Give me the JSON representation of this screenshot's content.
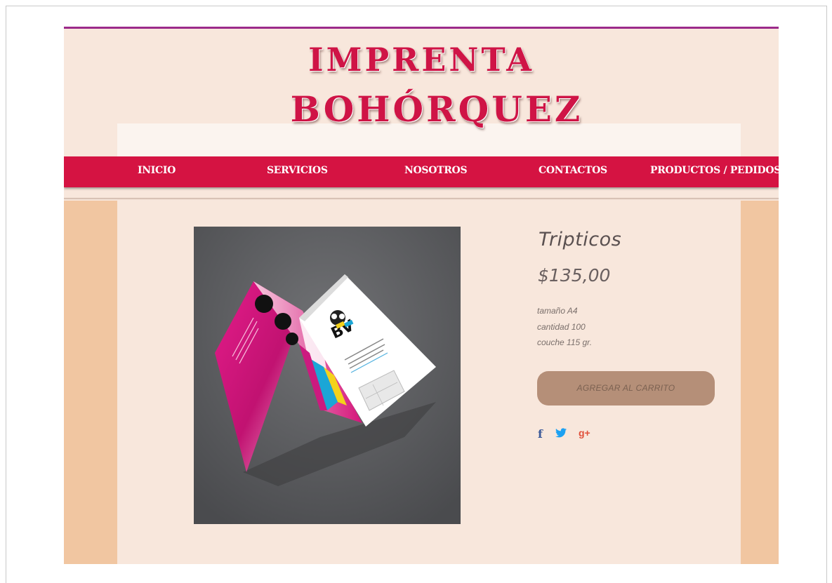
{
  "header": {
    "title_line1": "IMPRENTA",
    "title_line2": "BOHÓRQUEZ"
  },
  "nav": {
    "items": [
      "INICIO",
      "SERVICIOS",
      "NOSOTROS",
      "CONTACTOS",
      "PRODUCTOS / PEDIDOS"
    ]
  },
  "product": {
    "name": "Tripticos",
    "price": "$135,00",
    "details": [
      "tamaño A4",
      "cantidad 100",
      "couche 115 gr."
    ],
    "cart_button": "AGREGAR AL CARRITO",
    "image_logo_text": "BV"
  },
  "social": {
    "facebook": "f",
    "twitter": "twitter-icon",
    "googleplus": "g+"
  },
  "colors": {
    "accent": "#d51342",
    "page_bg": "#f1c6a1",
    "panel_bg": "#f8e7dc",
    "cart_button": "#b58f78",
    "top_strip": "#9c2a8a"
  }
}
